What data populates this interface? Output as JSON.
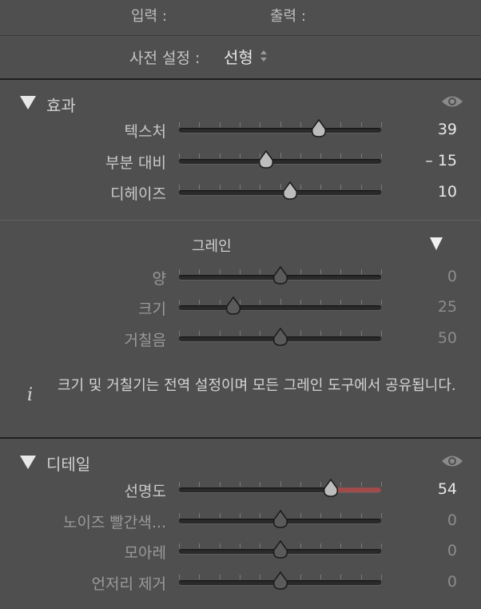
{
  "header": {
    "input_label": "입력 :",
    "output_label": "출력 :"
  },
  "preset": {
    "label": "사전 설정 :",
    "value": "선형"
  },
  "effects": {
    "title": "효과",
    "sliders": [
      {
        "label": "텍스처",
        "value": "39",
        "level": 0.69
      },
      {
        "label": "부분 대비",
        "value": "– 15",
        "level": 0.43
      },
      {
        "label": "디헤이즈",
        "value": "10",
        "level": 0.55
      }
    ]
  },
  "grain": {
    "title": "그레인",
    "sliders": [
      {
        "label": "양",
        "value": "0",
        "level": 0.5
      },
      {
        "label": "크기",
        "value": "25",
        "level": 0.27
      },
      {
        "label": "거칠음",
        "value": "50",
        "level": 0.5
      }
    ],
    "info": "크기 및 거칠기는 전역 설정이며 모든 그레인 도구에서 공유됩니다.",
    "info_icon": "i"
  },
  "detail": {
    "title": "디테일",
    "sliders": [
      {
        "label": "선명도",
        "value": "54",
        "level": 0.75
      },
      {
        "label": "노이즈 빨간색...",
        "value": "0",
        "level": 0.5
      },
      {
        "label": "모아레",
        "value": "0",
        "level": 0.5
      },
      {
        "label": "언저리 제거",
        "value": "0",
        "level": 0.5
      }
    ]
  },
  "colors": {
    "accent_red": "#a04a4a",
    "bg": "#4f4f4f"
  }
}
